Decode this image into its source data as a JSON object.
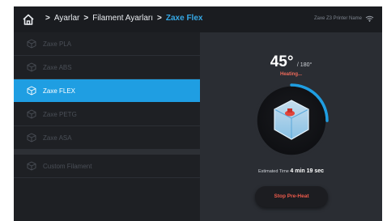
{
  "breadcrumb": {
    "items": [
      "Ayarlar",
      "Filament Ayarları"
    ],
    "current": "Zaxe Flex",
    "separator": ">"
  },
  "printer_name": "Zaxe Z3 Printer Name",
  "filaments": [
    {
      "label": "Zaxe PLA",
      "active": false
    },
    {
      "label": "Zaxe ABS",
      "active": false
    },
    {
      "label": "Zaxe FLEX",
      "active": true
    },
    {
      "label": "Zaxe PETG",
      "active": false
    },
    {
      "label": "Zaxe ASA",
      "active": false
    }
  ],
  "custom_filament_label": "Custom Filament",
  "heating": {
    "current_temp": "45°",
    "target_temp": "/ 180°",
    "status": "Heating...",
    "progress": 0.25,
    "eta_label": "Estimated Time",
    "eta_value": "4 min 19 sec",
    "stop_label": "Stop Pre-Heat"
  },
  "colors": {
    "accent": "#1f9ee2",
    "background": "#1f2126",
    "danger": "#ef5b4c"
  },
  "icons": {
    "home": "home-icon",
    "wifi": "wifi-icon",
    "filament": "cube-icon"
  }
}
